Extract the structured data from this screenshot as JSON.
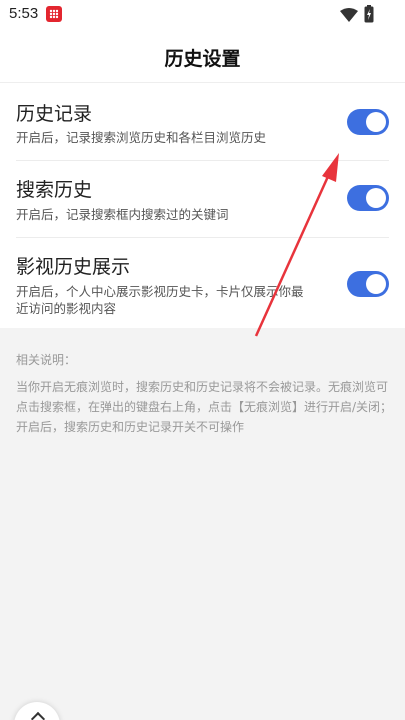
{
  "status_bar": {
    "time": "5:53",
    "app_icon": "red-app-icon",
    "wifi_icon": "wifi-icon",
    "battery_icon": "battery-charging-icon"
  },
  "header": {
    "title": "历史设置"
  },
  "settings": [
    {
      "title": "历史记录",
      "description": "开启后，记录搜索浏览历史和各栏目浏览历史",
      "enabled": true
    },
    {
      "title": "搜索历史",
      "description": "开启后，记录搜索框内搜索过的关键词",
      "enabled": true
    },
    {
      "title": "影视历史展示",
      "description": "开启后，个人中心展示影视历史卡，卡片仅展示你最近访问的影视内容",
      "enabled": true
    }
  ],
  "help": {
    "title": "相关说明：",
    "text": "当你开启无痕浏览时，搜索历史和历史记录将不会被记录。无痕浏览可点击搜索框，在弹出的键盘右上角，点击【无痕浏览】进行开启/关闭；开启后，搜索历史和历史记录开关不可操作"
  },
  "colors": {
    "toggle_on": "#3d6fe0",
    "annotation_arrow": "#e8343c"
  }
}
